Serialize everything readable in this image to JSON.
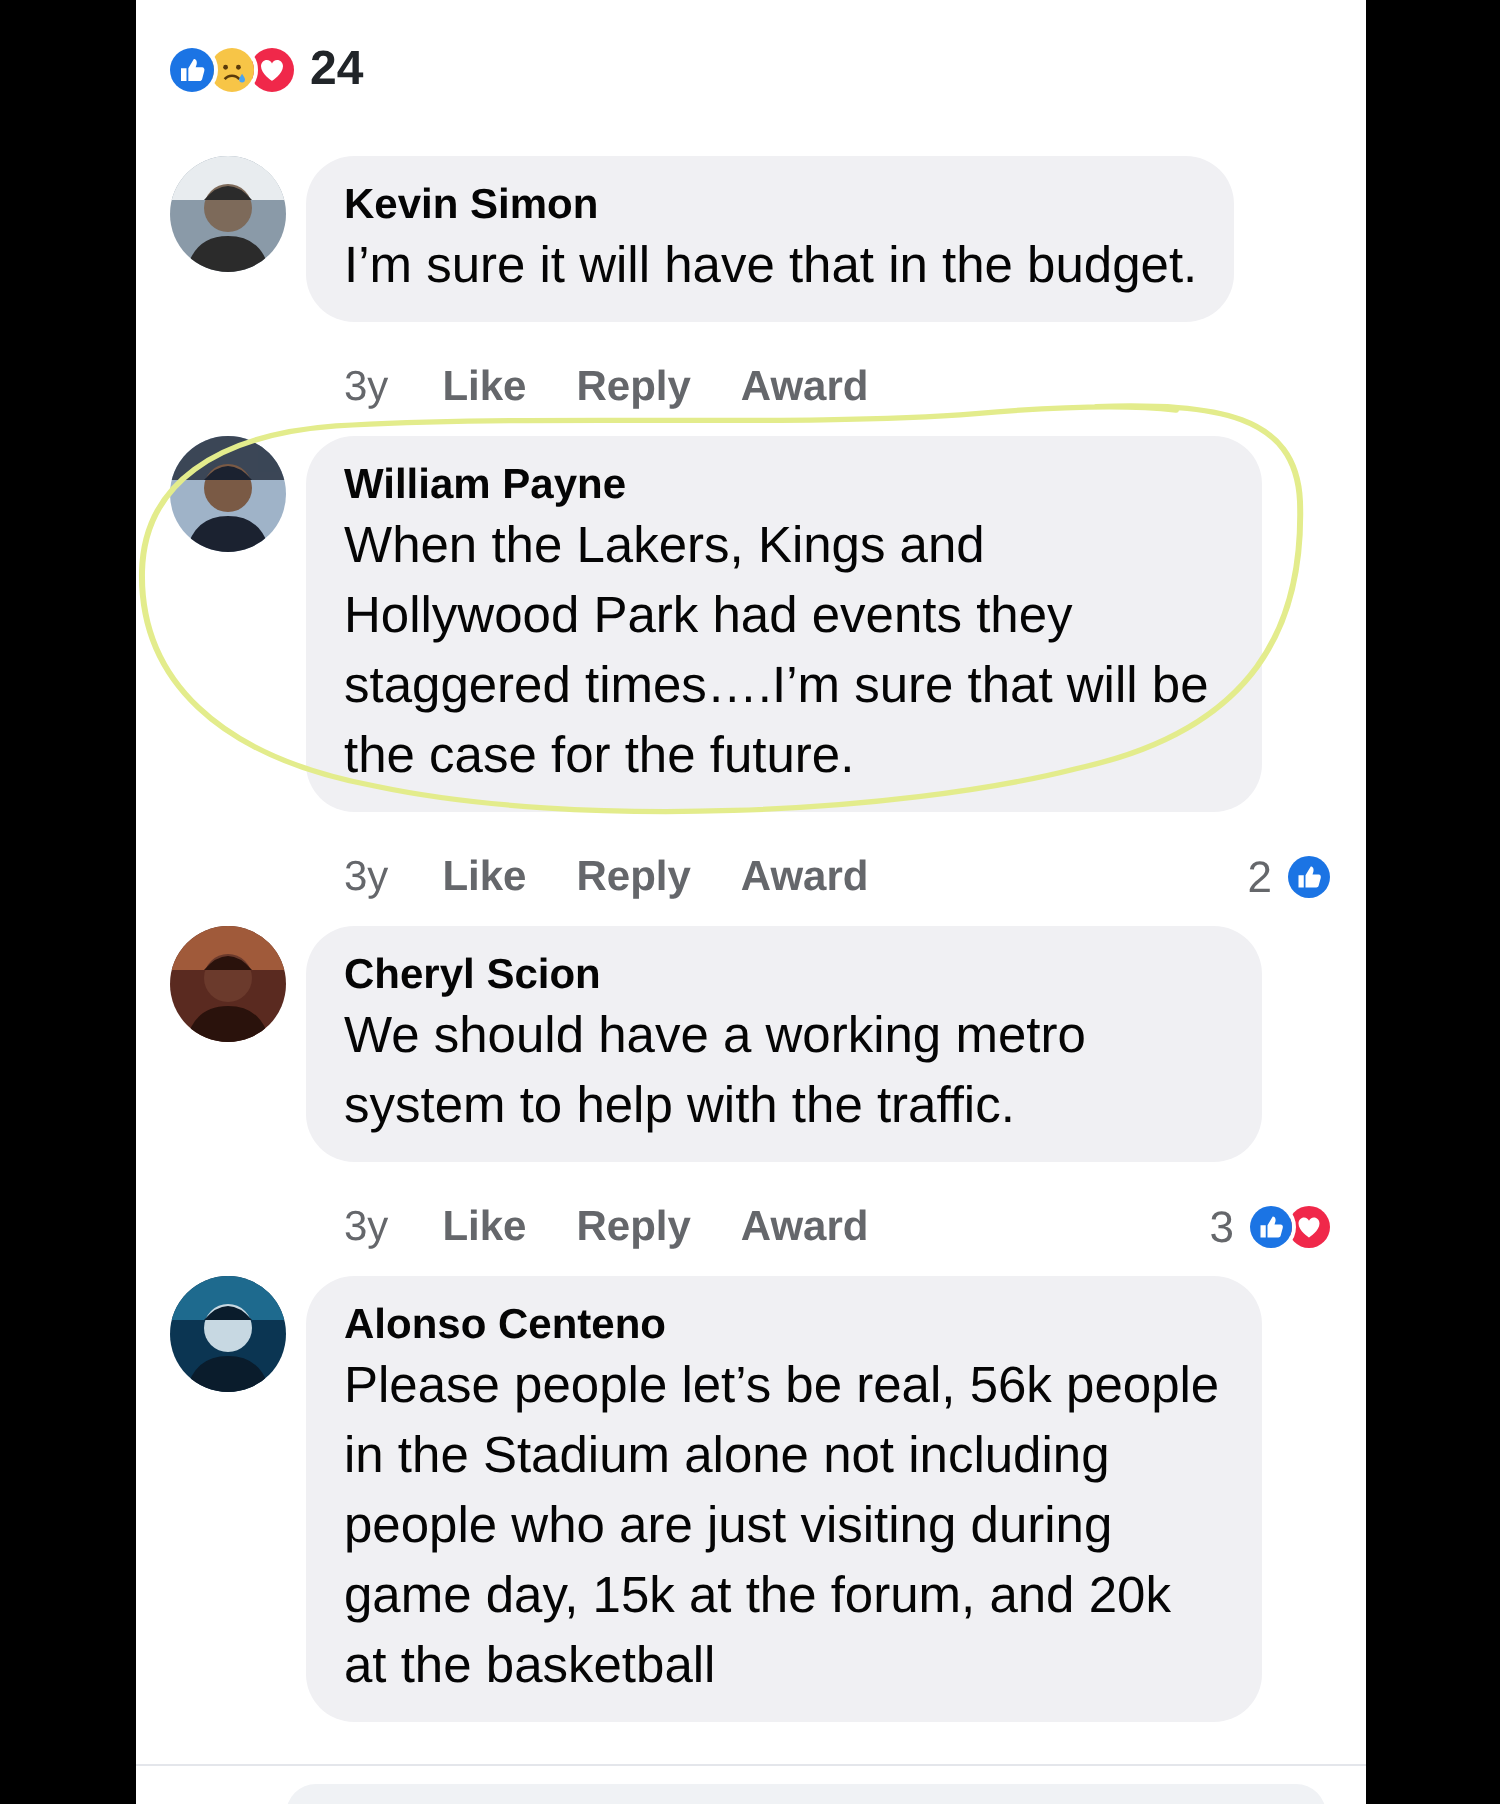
{
  "post_reactions": {
    "types": [
      {
        "kind": "like"
      },
      {
        "kind": "sad"
      },
      {
        "kind": "love"
      }
    ],
    "count": "24"
  },
  "comments": [
    {
      "author": "Kevin Simon",
      "text": "I’m sure it will have that in the budget.",
      "time": "3y",
      "actions": [
        "Like",
        "Reply",
        "Award"
      ],
      "highlighted": false,
      "avatar": {
        "kind": "picture"
      }
    },
    {
      "author": "William Payne",
      "text": "When the Lakers, Kings and Hollywood Park had events they staggered times….I’m sure that will be the case for the future.",
      "time": "3y",
      "actions": [
        "Like",
        "Reply",
        "Award"
      ],
      "highlighted": true,
      "reaction_count": "2",
      "reaction_types": [
        {
          "kind": "like"
        }
      ],
      "avatar": {
        "kind": "picture"
      }
    },
    {
      "author": "Cheryl Scion",
      "text": "We should have a working metro system to help with the traffic.",
      "time": "3y",
      "actions": [
        "Like",
        "Reply",
        "Award"
      ],
      "highlighted": false,
      "reaction_count": "3",
      "reaction_types": [
        {
          "kind": "like"
        },
        {
          "kind": "love"
        }
      ],
      "avatar": {
        "kind": "picture"
      }
    },
    {
      "author": "Alonso Centeno",
      "text": "Please people let’s be real, 56k people in the Stadium alone not including people who are just visiting during game day, 15k at the forum, and 20k at the basketball",
      "highlighted": false,
      "avatar": {
        "kind": "picture"
      }
    }
  ]
}
